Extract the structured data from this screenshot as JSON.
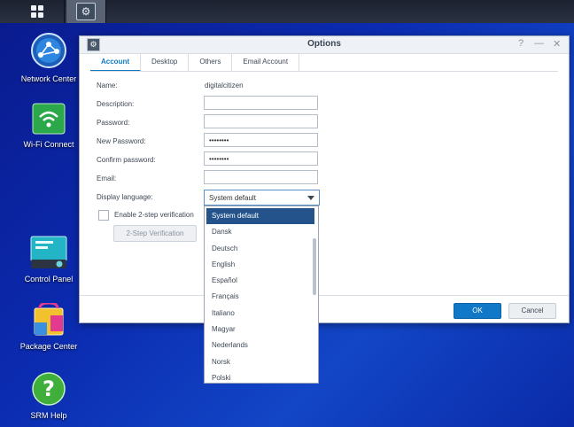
{
  "desktop": {
    "icons": [
      {
        "label": "Network Center"
      },
      {
        "label": "Wi-Fi Connect"
      },
      {
        "label": "Control Panel"
      },
      {
        "label": "Package Center"
      },
      {
        "label": "SRM Help"
      }
    ]
  },
  "window": {
    "title": "Options",
    "controls": {
      "help": "?",
      "minimize": "—",
      "close": "✕"
    },
    "tabs": [
      {
        "label": "Account",
        "active": true
      },
      {
        "label": "Desktop",
        "active": false
      },
      {
        "label": "Others",
        "active": false
      },
      {
        "label": "Email Account",
        "active": false
      }
    ],
    "form": {
      "name_label": "Name:",
      "name_value": "digitalcitizen",
      "description_label": "Description:",
      "description_value": "",
      "password_label": "Password:",
      "password_value": "",
      "new_password_label": "New Password:",
      "new_password_value": "••••••••",
      "confirm_password_label": "Confirm password:",
      "confirm_password_value": "••••••••",
      "email_label": "Email:",
      "email_value": "",
      "display_language_label": "Display language:",
      "display_language_value": "System default",
      "two_step_label": "Enable 2-step verification",
      "two_step_button": "2-Step Verification"
    },
    "buttons": {
      "ok": "OK",
      "cancel": "Cancel"
    }
  },
  "language_dropdown": {
    "options": [
      "System default",
      "Dansk",
      "Deutsch",
      "English",
      "Español",
      "Français",
      "Italiano",
      "Magyar",
      "Nederlands",
      "Norsk",
      "Polski"
    ],
    "selected": "System default"
  },
  "colors": {
    "accent": "#0f7ac4",
    "ok_button": "#1177c7",
    "dropdown_selected": "#23538a"
  }
}
